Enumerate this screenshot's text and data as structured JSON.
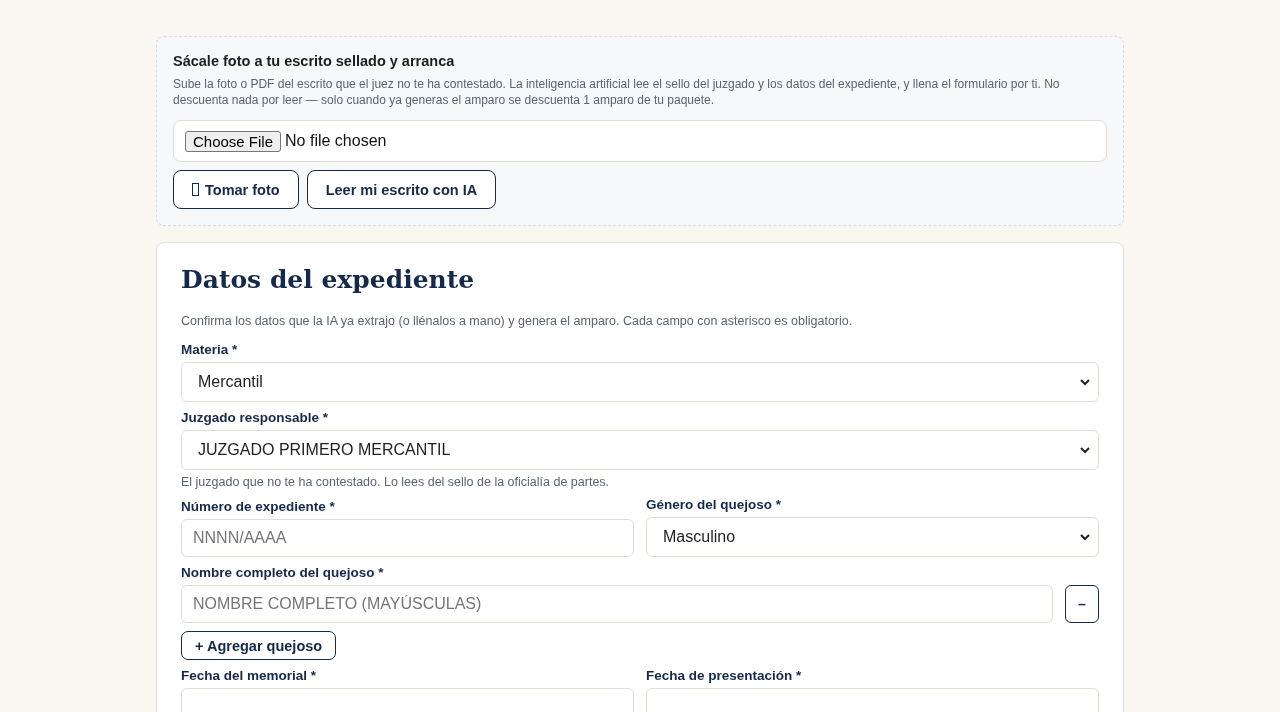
{
  "upload": {
    "title": "Sácale foto a tu escrito sellado y arranca",
    "description": "Sube la foto o PDF del escrito que el juez no te ha contestado. La inteligencia artificial lee el sello del juzgado y los datos del expediente, y llena el formulario por ti. No descuenta nada por leer — solo cuando ya generas el amparo se descuenta 1 amparo de tu paquete.",
    "file_button": "Choose File",
    "file_status": "No file chosen",
    "buttons": [
      {
        "label": "Tomar foto",
        "kind": "glyph"
      },
      {
        "label": "Leer mi escrito con IA",
        "kind": "plain"
      }
    ]
  },
  "form": {
    "title": "Datos del expediente",
    "intro": "Confirma los datos que la IA ya extrajo (o llénalos a mano) y genera el amparo. Cada campo con asterisco es obligatorio.",
    "rows": [
      {
        "kind": "full",
        "fields": [
          {
            "label": "Materia *",
            "kind": "select",
            "value": "Mercantil"
          }
        ]
      },
      {
        "kind": "full",
        "fields": [
          {
            "label": "Juzgado responsable *",
            "kind": "select",
            "value": "JUZGADO PRIMERO MERCANTIL",
            "hint": "El juzgado que no te ha contestado. Lo lees del sello de la oficialía de partes."
          }
        ]
      },
      {
        "kind": "pair",
        "fields": [
          {
            "label": "Número de expediente *",
            "kind": "input",
            "placeholder": "NNNN/AAAA"
          },
          {
            "label": "Género del quejoso *",
            "kind": "select",
            "value": "Masculino"
          }
        ]
      },
      {
        "kind": "removable",
        "fields": [
          {
            "label": "Nombre completo del quejoso *",
            "kind": "input",
            "placeholder": "NOMBRE COMPLETO (MAYÚSCULAS)",
            "remove": "–"
          }
        ]
      },
      {
        "kind": "add",
        "label": "+ Agregar quejoso"
      },
      {
        "kind": "pair",
        "fields": [
          {
            "label": "Fecha del memorial *",
            "kind": "input"
          },
          {
            "label": "Fecha de presentación *",
            "kind": "input"
          }
        ]
      }
    ]
  }
}
